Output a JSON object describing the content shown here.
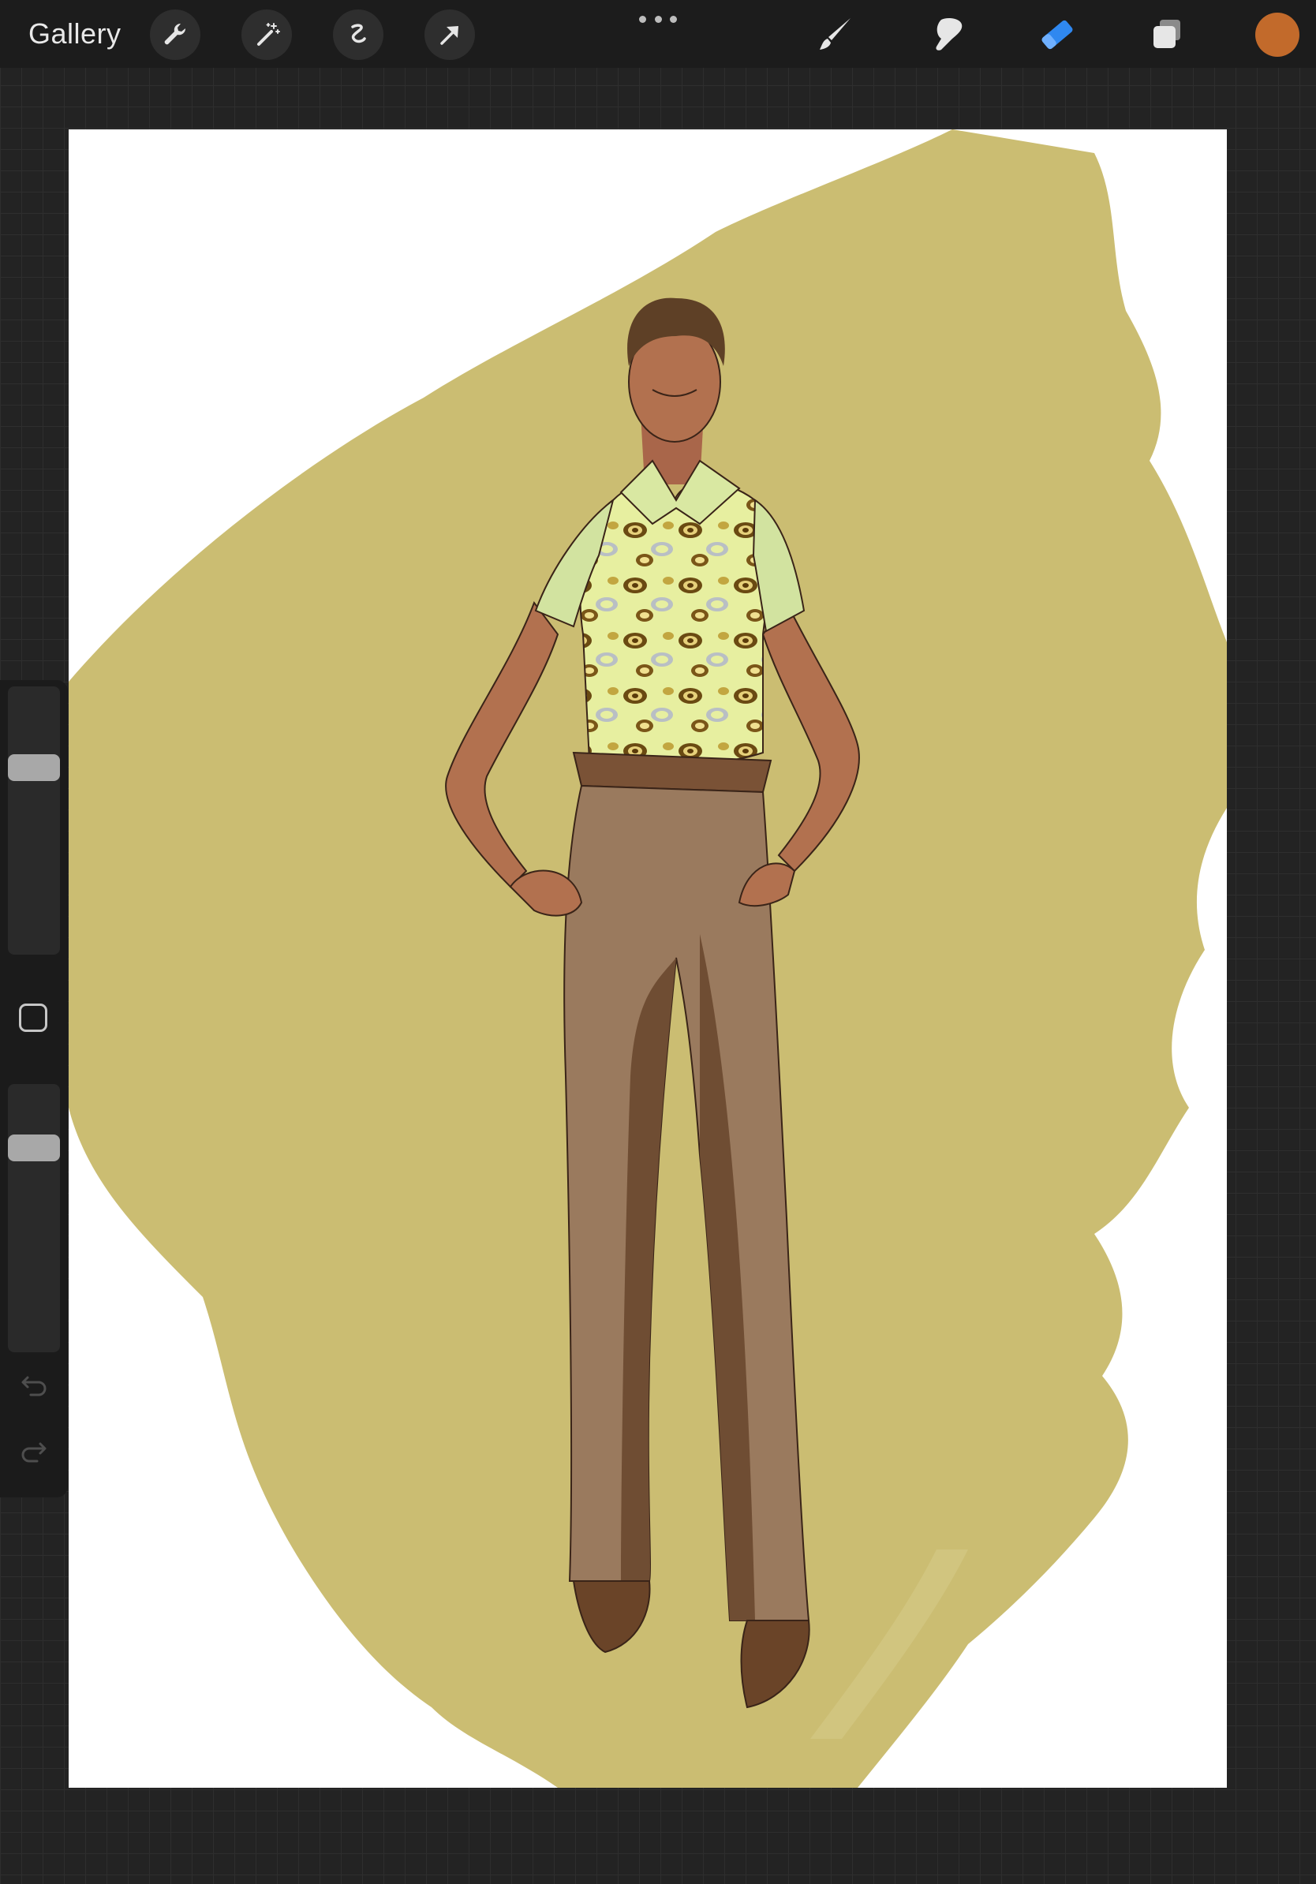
{
  "topbar": {
    "gallery_label": "Gallery",
    "left_tools": [
      "wrench-icon",
      "magic-wand-icon",
      "selection-icon",
      "transform-arrow-icon"
    ],
    "right_tools": [
      "brush-icon",
      "smudge-icon",
      "eraser-icon",
      "layers-icon"
    ],
    "active_tool": "eraser-icon",
    "current_color": "#c26a2b"
  },
  "sidebar": {
    "brush_size": 0.72,
    "brush_opacity": 0.79
  },
  "canvas": {
    "background_wash_color": "#cbbd72",
    "shirt_color": "#e4efa6",
    "trousers_color": "#9a7a5e",
    "skin_color": "#b2714f",
    "hair_color": "#5e4026"
  }
}
